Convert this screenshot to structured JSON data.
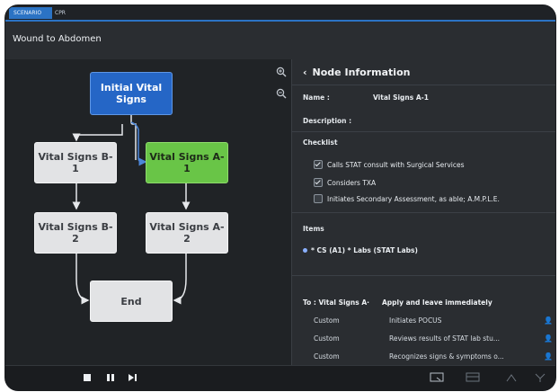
{
  "tabs": [
    "SCENARIO",
    "CPR"
  ],
  "title": "Wound to Abdomen",
  "flow": {
    "nodes": {
      "initial": "Initial Vital Signs",
      "b1": "Vital Signs B-1",
      "a1": "Vital Signs A-1",
      "b2": "Vital Signs B-2",
      "a2": "Vital Signs A-2",
      "end": "End"
    }
  },
  "panel": {
    "back_icon": "chevron-left-icon",
    "heading": "Node Information",
    "name_label": "Name :",
    "name_value": "Vital Signs A-1",
    "description_label": "Description :",
    "checklist_label": "Checklist",
    "checklist": [
      {
        "text": "Calls STAT consult with Surgical Services",
        "checked": true
      },
      {
        "text": "Considers TXA",
        "checked": true
      },
      {
        "text": "Initiates Secondary Assessment, as able; A.M.P.L.E.",
        "checked": false
      }
    ],
    "items_label": "Items",
    "items_text": "* CS (A1)  * Labs (STAT Labs)",
    "transitions": [
      {
        "col1": "To : Vital Signs A·",
        "col2": "Apply and leave immediately",
        "icon": ""
      },
      {
        "col1": "Custom",
        "col2": "Initiates POCUS",
        "icon": "user-icon"
      },
      {
        "col1": "Custom",
        "col2": "Reviews results of STAT lab stu...",
        "icon": "user-icon"
      },
      {
        "col1": "Custom",
        "col2": "Recognizes signs & symptoms o...",
        "icon": "user-icon"
      }
    ]
  },
  "controls": {
    "stop": "stop-icon",
    "pause": "pause-icon",
    "next": "skip-next-icon"
  },
  "colors": {
    "accent_blue": "#2b73c4",
    "node_blue": "#2566c6",
    "node_green": "#69c547",
    "node_gray": "#e2e3e5"
  }
}
